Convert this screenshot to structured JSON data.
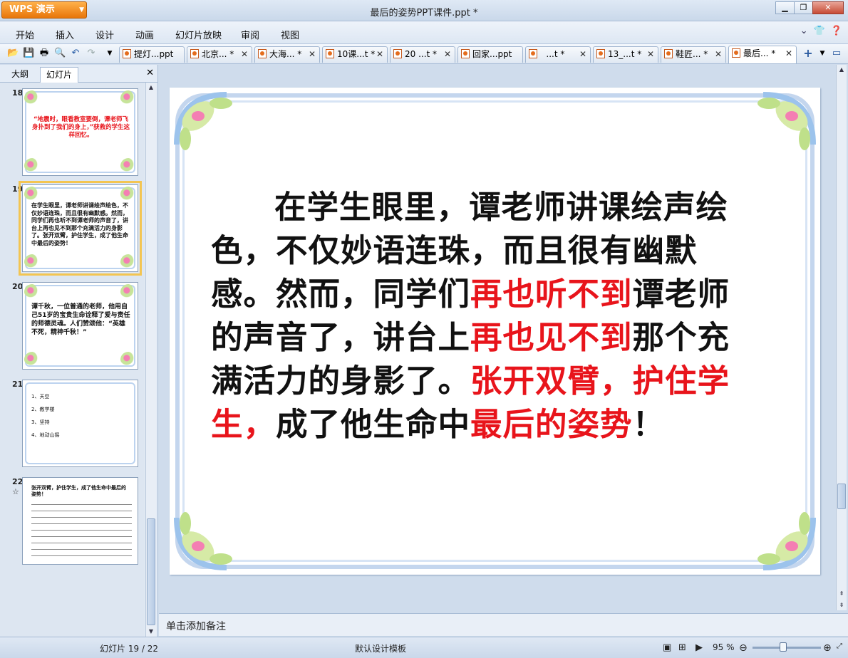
{
  "app": {
    "name": "WPS 演示",
    "document_title": "最后的姿势PPT课件.ppt *"
  },
  "menu": [
    "开始",
    "插入",
    "设计",
    "动画",
    "幻灯片放映",
    "审阅",
    "视图"
  ],
  "tabs": [
    {
      "label": "提灯...ppt"
    },
    {
      "label": "北京... *"
    },
    {
      "label": "大海... *"
    },
    {
      "label": "10课...t *"
    },
    {
      "label": "20 ...t *"
    },
    {
      "label": "回家...ppt"
    },
    {
      "label": "  ...t *"
    },
    {
      "label": "13_...t *"
    },
    {
      "label": "鞋匠... *"
    },
    {
      "label": "最后... *"
    }
  ],
  "panel": {
    "tab_outline": "大纲",
    "tab_slides": "幻灯片"
  },
  "thumbs": [
    {
      "num": "18",
      "text": "“地震时，眼看教室要倒，谭老师飞身扑到了我们的身上，”获救的学生这样回忆。"
    },
    {
      "num": "19",
      "text": "在学生眼里，谭老师讲课绘声绘色，不仅妙语连珠，而且很有幽默感。然而，同学们再也听不到谭老师的声音了，讲台上再也见不到那个充满活力的身影了。张开双臂，护住学生，成了他生命中最后的姿势！"
    },
    {
      "num": "20",
      "text": "谭千秋，一位普通的老师，他用自己51岁的宝贵生命诠释了爱与责任的师德灵魂。人们赞颂他：“英雄不死，精神千秋！”"
    },
    {
      "num": "21",
      "items": [
        "1、天空",
        "2、教学楼",
        "3、坚持",
        "4、地动山摇"
      ]
    },
    {
      "num": "22",
      "text": "张开双臂，护住学生，成了他生命中最后的姿势！"
    }
  ],
  "slide": {
    "seg1": "在学生眼里，谭老师讲课绘声绘色，不仅妙语连珠，而且很有幽默感。然而，同学们",
    "seg2": "再也听不到",
    "seg3": "谭老师的声音了，讲台上",
    "seg4": "再也见不到",
    "seg5": "那个充满活力的身影了。",
    "seg6": "张开双臂，护住学生，",
    "seg7": "成了他生命中",
    "seg8": "最后的姿势",
    "seg9": "！"
  },
  "notes_placeholder": "单击添加备注",
  "status": {
    "slide_counter": "幻灯片 19 / 22",
    "template": "默认设计模板",
    "zoom": "95 %"
  },
  "colors": {
    "accent_red": "#e8141b",
    "title_orange": "#f08a1e"
  }
}
